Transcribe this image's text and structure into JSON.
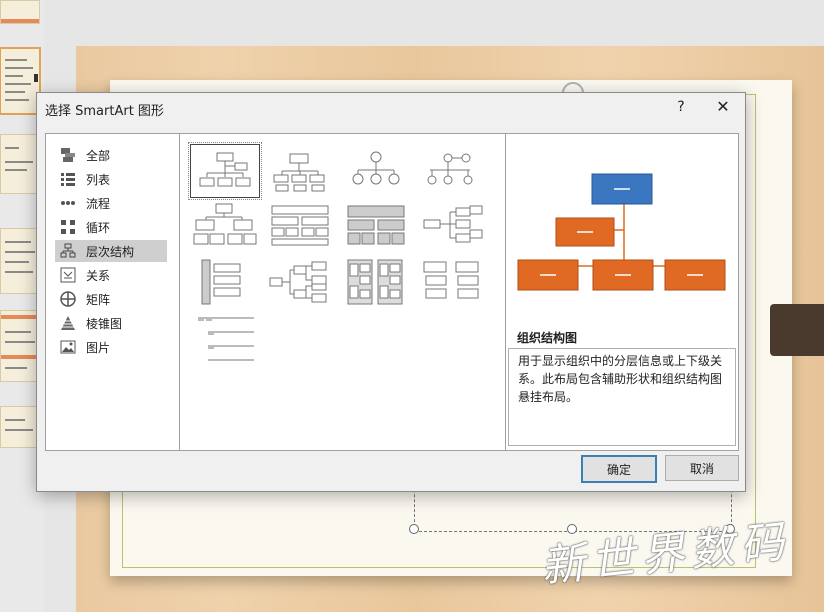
{
  "dialog": {
    "title": "选择 SmartArt 图形",
    "help_label": "?",
    "close_label": "✕",
    "ok_label": "确定",
    "cancel_label": "取消"
  },
  "categories": [
    {
      "label": "全部",
      "icon": "all-icon"
    },
    {
      "label": "列表",
      "icon": "list-icon"
    },
    {
      "label": "流程",
      "icon": "process-icon"
    },
    {
      "label": "循环",
      "icon": "cycle-icon"
    },
    {
      "label": "层次结构",
      "icon": "hierarchy-icon",
      "selected": true
    },
    {
      "label": "关系",
      "icon": "relationship-icon"
    },
    {
      "label": "矩阵",
      "icon": "matrix-icon"
    },
    {
      "label": "棱锥图",
      "icon": "pyramid-icon"
    },
    {
      "label": "图片",
      "icon": "picture-icon"
    }
  ],
  "preview": {
    "layout_name": "组织结构图",
    "description": "用于显示组织中的分层信息或上下级关系。此布局包含辅助形状和组织结构图悬挂布局。",
    "colors": {
      "top": "#3b76c0",
      "child": "#e06a24",
      "line": "#e06a24"
    }
  },
  "watermark": "新世界数码"
}
